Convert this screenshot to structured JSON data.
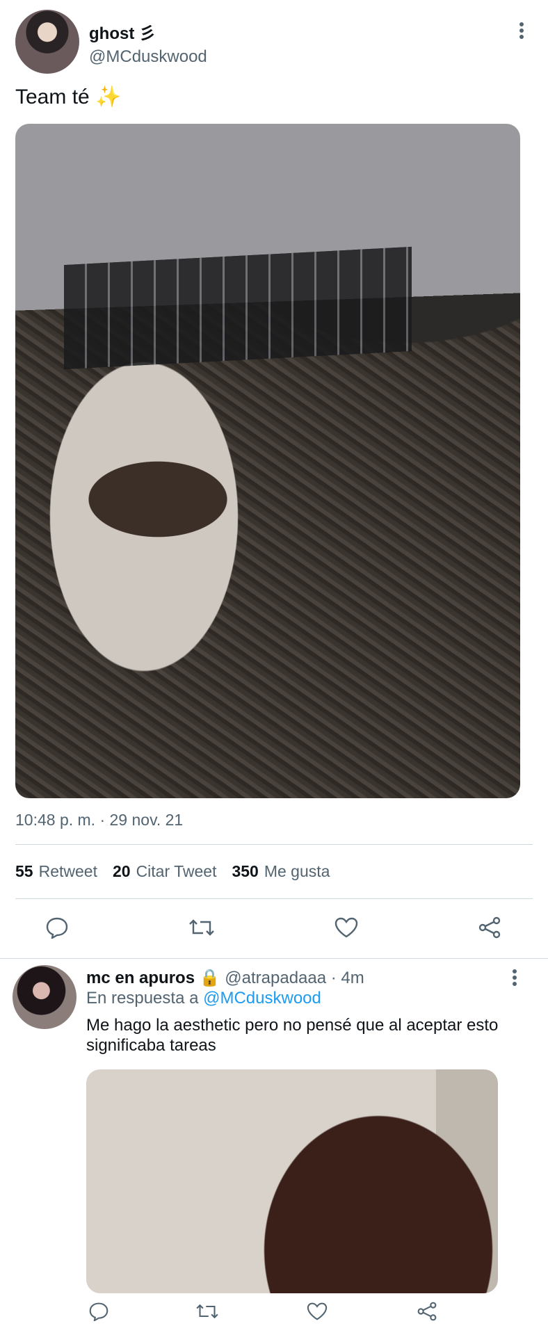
{
  "tweet": {
    "author_name": "ghost 彡",
    "handle": "@MCduskwood",
    "text": "Team té",
    "emoji": "✨",
    "timestamp": "10:48 p. m. · 29 nov. 21",
    "stats": {
      "retweets": "55",
      "retweets_label": "Retweet",
      "quotes": "20",
      "quotes_label": "Citar Tweet",
      "likes": "350",
      "likes_label": "Me gusta"
    }
  },
  "reply": {
    "author_name": "mc en apuros",
    "lock_icon": "🔒",
    "handle_time": "@atrapadaaa · 4m",
    "in_reply_prefix": "En respuesta a",
    "in_reply_handle": "@MCduskwood",
    "text_line1": "Me hago la aesthetic pero no pensé que al aceptar esto",
    "text_line2": "significaba tareas"
  },
  "icons": [
    "more-icon",
    "reply-icon",
    "retweet-icon",
    "like-icon",
    "share-icon"
  ],
  "colors": {
    "link": "#1d9bf0",
    "muted": "#536471",
    "text": "#0f1419"
  }
}
